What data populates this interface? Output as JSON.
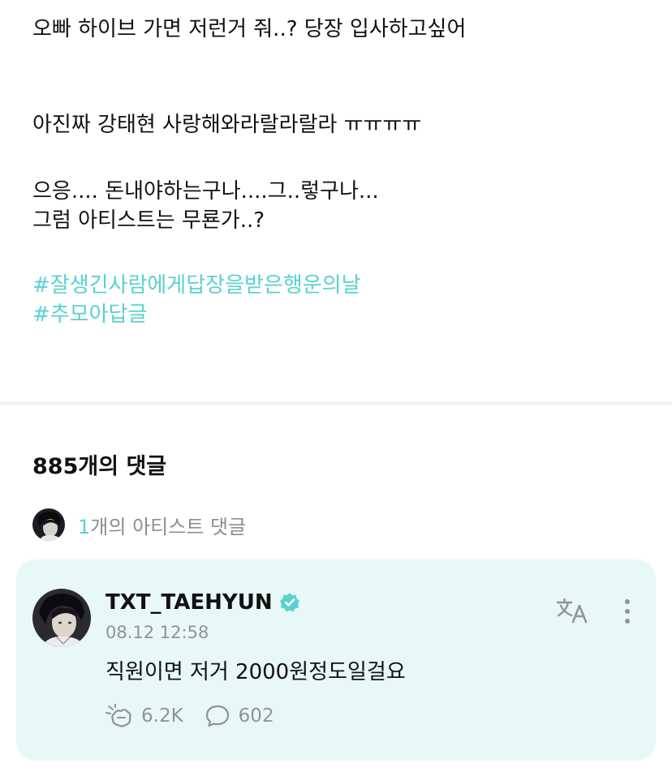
{
  "post": {
    "line1": "오빠 하이브 가면 저런거 줘..? 당장 입사하고싶어",
    "line2": "아진짜 강태현 사랑해와라랄라랄라 ㅠㅠㅠㅠ",
    "line3": "으응.... 돈내야하는구나....그..렇구나...",
    "line4": "그럼 아티스트는 무룐가..?",
    "hashtags": [
      "#잘생긴사람에게답장을받은행운의날",
      "#추모아답글"
    ]
  },
  "comments": {
    "count_label": "885개의 댓글",
    "artist_count": "1",
    "artist_label": "개의 아티스트 댓글"
  },
  "artist_comment": {
    "username": "TXT_TAEHYUN",
    "time": "08.12 12:58",
    "text": "직원이면 저거 2000원정도일걸요",
    "likes": "6.2K",
    "replies": "602"
  },
  "colors": {
    "accent": "#5ad1d1",
    "card_bg": "#e7f8f7",
    "muted": "#8f9499"
  },
  "icons": [
    "verified-icon",
    "translate-icon",
    "more-icon",
    "cheer-icon",
    "reply-icon"
  ]
}
